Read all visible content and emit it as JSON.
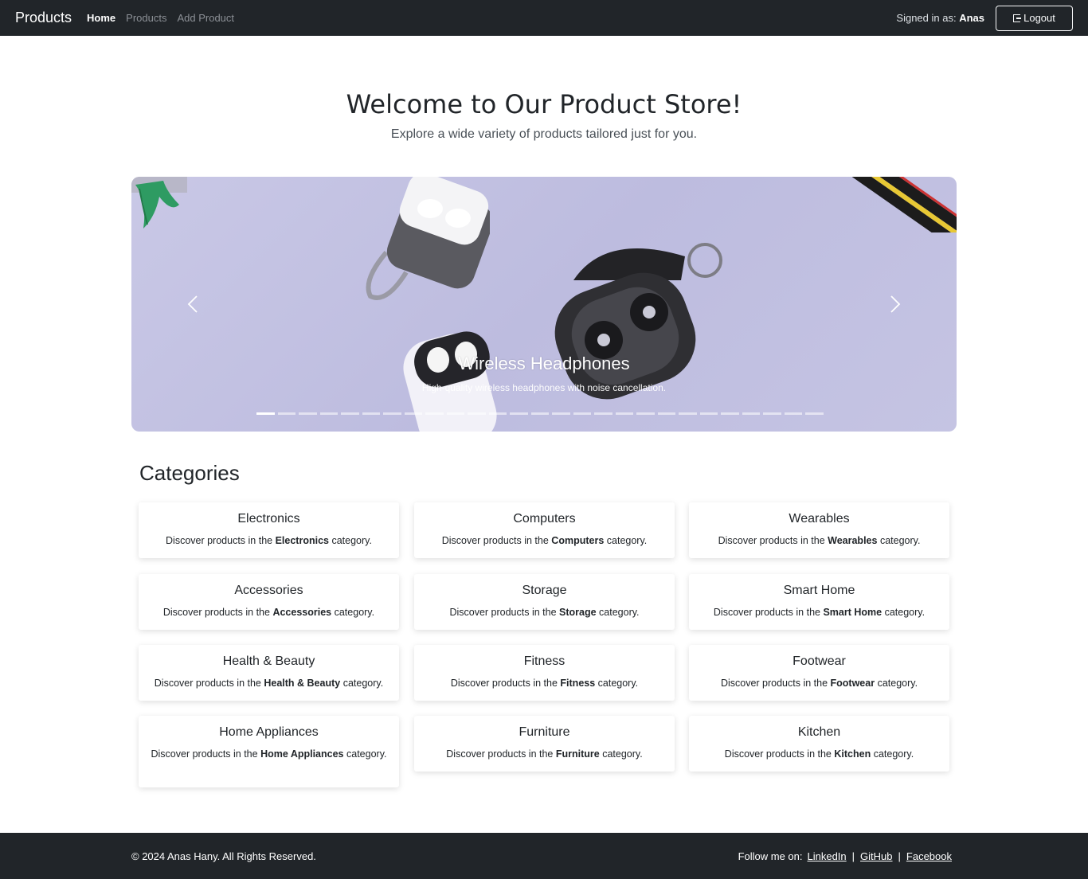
{
  "navbar": {
    "brand": "Products",
    "links": [
      {
        "label": "Home",
        "active": true
      },
      {
        "label": "Products",
        "active": false
      },
      {
        "label": "Add Product",
        "active": false
      }
    ],
    "signed_prefix": "Signed in as:",
    "username": "Anas",
    "logout_label": "Logout"
  },
  "hero": {
    "title": "Welcome to Our Product Store!",
    "subtitle": "Explore a wide variety of products tailored just for you."
  },
  "carousel": {
    "slide_title": "Wireless Headphones",
    "slide_desc": "High-quality wireless headphones with noise cancellation.",
    "slide_count": 27,
    "active_index": 0
  },
  "categories": {
    "heading": "Categories",
    "desc_prefix": "Discover products in the",
    "desc_suffix": "category.",
    "items": [
      "Electronics",
      "Computers",
      "Wearables",
      "Accessories",
      "Storage",
      "Smart Home",
      "Health & Beauty",
      "Fitness",
      "Footwear",
      "Home Appliances",
      "Furniture",
      "Kitchen"
    ]
  },
  "footer": {
    "copyright": "© 2024 Anas Hany. All Rights Reserved.",
    "follow_label": "Follow me on:",
    "links": [
      "LinkedIn",
      "GitHub",
      "Facebook"
    ],
    "separator": "|"
  }
}
